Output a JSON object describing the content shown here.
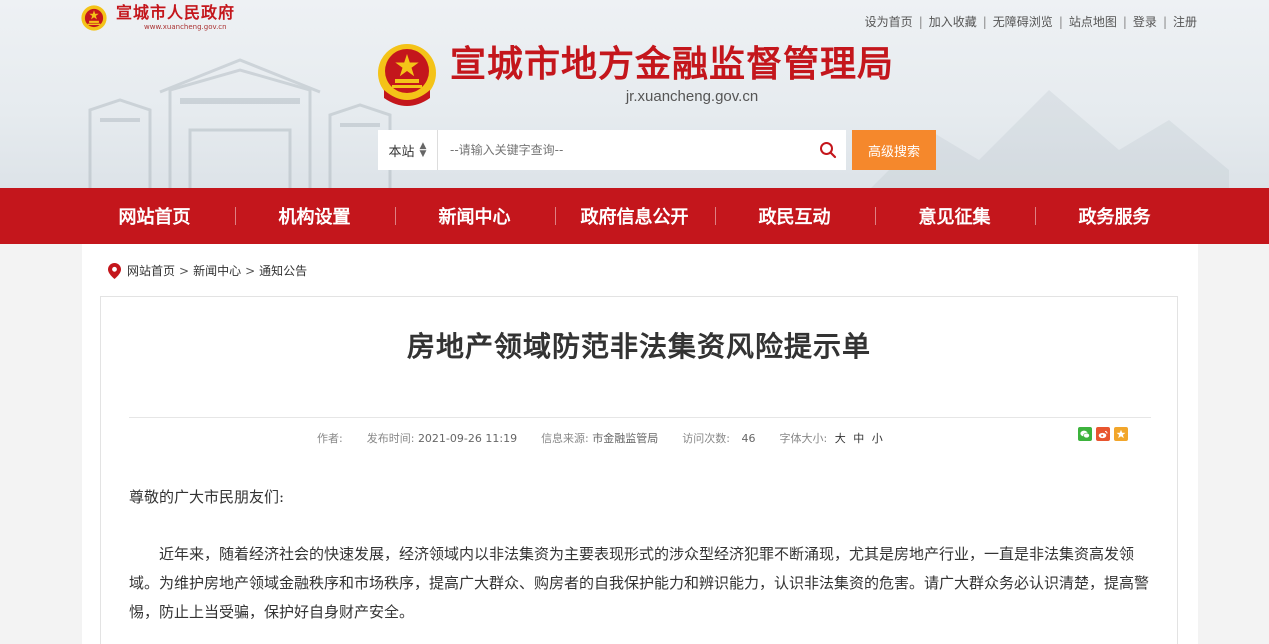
{
  "header": {
    "top_logo": {
      "name": "宣城市人民政府",
      "domain": "www.xuancheng.gov.cn"
    },
    "top_links": [
      "设为首页",
      "加入收藏",
      "无障碍浏览",
      "站点地图",
      "登录",
      "注册"
    ],
    "brand": {
      "title": "宣城市地方金融监督管理局",
      "domain": "jr.xuancheng.gov.cn"
    },
    "search": {
      "scope": "本站",
      "placeholder": "--请输入关键字查询--",
      "advanced_label": "高级搜索"
    }
  },
  "nav": {
    "items": [
      "网站首页",
      "机构设置",
      "新闻中心",
      "政府信息公开",
      "政民互动",
      "意见征集",
      "政务服务"
    ]
  },
  "breadcrumb": {
    "items": [
      "网站首页",
      "新闻中心",
      "通知公告"
    ],
    "separator": ">"
  },
  "article": {
    "title": "房地产领域防范非法集资风险提示单",
    "meta": {
      "author_label": "作者:",
      "author": "",
      "publish_label": "发布时间:",
      "publish_time": "2021-09-26 11:19",
      "source_label": "信息来源:",
      "source": "市金融监管局",
      "views_label": "访问次数:",
      "views": "46",
      "fontsize_label": "字体大小:",
      "font_large": "大",
      "font_medium": "中",
      "font_small": "小"
    },
    "greeting": "尊敬的广大市民朋友们:",
    "paragraph": "近年来，随着经济社会的快速发展，经济领域内以非法集资为主要表现形式的涉众型经济犯罪不断涌现，尤其是房地产行业，一直是非法集资高发领域。为维护房地产领域金融秩序和市场秩序，提高广大群众、购房者的自我保护能力和辨识能力，认识非法集资的危害。请广大群众务必认识清楚，提高警惕，防止上当受骗，保护好自身财产安全。"
  },
  "colors": {
    "brand_red": "#c4161c",
    "accent_orange": "#f5882c",
    "wechat_green": "#3db33d",
    "weibo_red": "#e8552f",
    "favorite_orange": "#f2a62b"
  },
  "icons": {
    "emblem": "national-emblem-icon",
    "pin": "location-pin-icon",
    "search": "search-icon",
    "share": [
      "wechat-icon",
      "weibo-icon",
      "favorite-icon"
    ]
  }
}
